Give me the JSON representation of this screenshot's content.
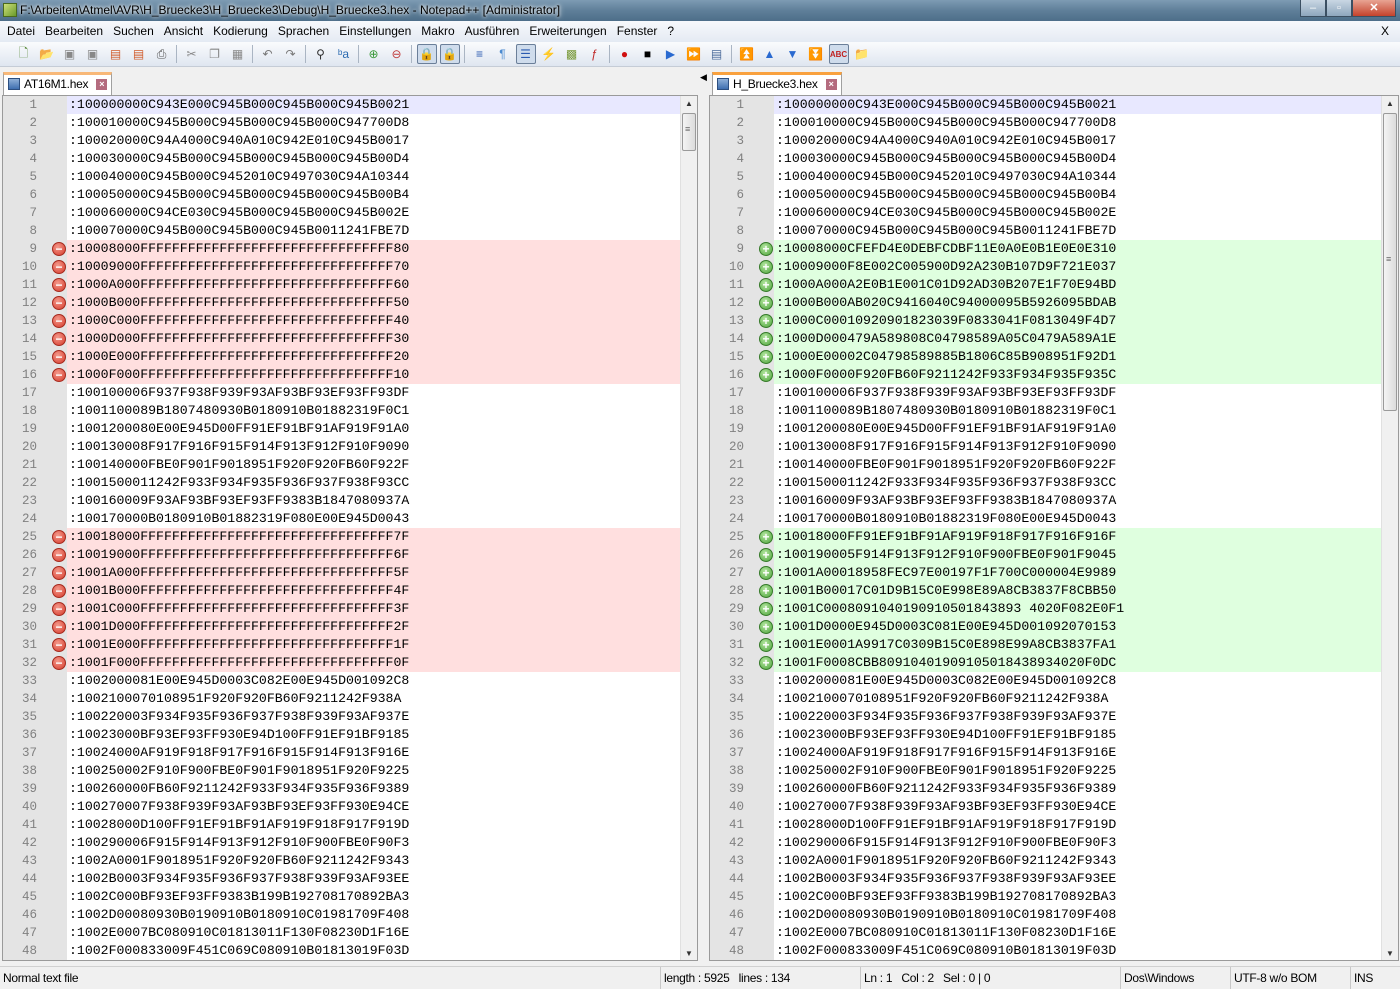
{
  "window": {
    "title": "F:\\Arbeiten\\Atmel\\AVR\\H_Bruecke3\\H_Bruecke3\\Debug\\H_Bruecke3.hex - Notepad++ [Administrator]",
    "minimize": "–",
    "maximize": "▫",
    "close": "✕"
  },
  "menu": {
    "items": [
      "Datei",
      "Bearbeiten",
      "Suchen",
      "Ansicht",
      "Kodierung",
      "Sprachen",
      "Einstellungen",
      "Makro",
      "Ausführen",
      "Erweiterungen",
      "Fenster",
      "?"
    ],
    "close": "X"
  },
  "toolbar": [
    {
      "name": "new-file-icon",
      "g": "🗋",
      "c": "#5a8a3a"
    },
    {
      "name": "open-file-icon",
      "g": "📂",
      "c": "#d9a520"
    },
    {
      "name": "save-icon",
      "g": "▣",
      "c": "#888"
    },
    {
      "name": "save-all-icon",
      "g": "▣",
      "c": "#888"
    },
    {
      "name": "close-icon",
      "g": "▤",
      "c": "#d05a2a"
    },
    {
      "name": "close-all-icon",
      "g": "▤",
      "c": "#d05a2a"
    },
    {
      "name": "print-icon",
      "g": "⎙",
      "c": "#555"
    },
    {
      "sep": true
    },
    {
      "name": "cut-icon",
      "g": "✂",
      "c": "#888"
    },
    {
      "name": "copy-icon",
      "g": "❐",
      "c": "#888"
    },
    {
      "name": "paste-icon",
      "g": "▦",
      "c": "#888"
    },
    {
      "sep": true
    },
    {
      "name": "undo-icon",
      "g": "↶",
      "c": "#777"
    },
    {
      "name": "redo-icon",
      "g": "↷",
      "c": "#777"
    },
    {
      "sep": true
    },
    {
      "name": "find-icon",
      "g": "⚲",
      "c": "#333"
    },
    {
      "name": "replace-icon",
      "g": "ᵇa",
      "c": "#2a6ab0"
    },
    {
      "sep": true
    },
    {
      "name": "zoom-in-icon",
      "g": "⊕",
      "c": "#3a9a3a"
    },
    {
      "name": "zoom-out-icon",
      "g": "⊖",
      "c": "#c03a3a"
    },
    {
      "sep": true
    },
    {
      "name": "sync-vertical-icon",
      "g": "🔒",
      "c": "#c9a030",
      "pressed": true
    },
    {
      "name": "sync-horizontal-icon",
      "g": "🔒",
      "c": "#c9a030",
      "pressed": true
    },
    {
      "sep": true
    },
    {
      "name": "word-wrap-icon",
      "g": "≡",
      "c": "#2a5ab0"
    },
    {
      "name": "show-all-chars-icon",
      "g": "¶",
      "c": "#4a8ad0"
    },
    {
      "name": "indent-guide-icon",
      "g": "☰",
      "c": "#2a5ab0",
      "pressed": true
    },
    {
      "name": "user-language-icon",
      "g": "⚡",
      "c": "#d0a020"
    },
    {
      "name": "document-map-icon",
      "g": "▩",
      "c": "#7a9a3a"
    },
    {
      "name": "function-list-icon",
      "g": "ƒ",
      "c": "#c02a2a"
    },
    {
      "sep": true
    },
    {
      "name": "record-macro-icon",
      "g": "●",
      "c": "#d01010"
    },
    {
      "name": "stop-macro-icon",
      "g": "■",
      "c": "#000"
    },
    {
      "name": "play-macro-icon",
      "g": "▶",
      "c": "#2a6ad0"
    },
    {
      "name": "run-macro-multiple-icon",
      "g": "⏩",
      "c": "#2a6ad0"
    },
    {
      "name": "save-macro-icon",
      "g": "▤",
      "c": "#4a6a9a"
    },
    {
      "sep": true
    },
    {
      "name": "first-diff-icon",
      "g": "⏫",
      "c": "#2a6ad0"
    },
    {
      "name": "prev-diff-icon",
      "g": "▲",
      "c": "#2a6ad0"
    },
    {
      "name": "next-diff-icon",
      "g": "▼",
      "c": "#2a6ad0"
    },
    {
      "name": "last-diff-icon",
      "g": "⏬",
      "c": "#2a6ad0"
    },
    {
      "name": "spell-check-icon",
      "g": "ABC",
      "c": "#c02020",
      "pressed": true
    },
    {
      "name": "plugin-folder-icon",
      "g": "📁",
      "c": "#d0a020"
    }
  ],
  "tabs": {
    "left": {
      "label": "AT16M1.hex"
    },
    "right": {
      "label": "H_Bruecke3.hex"
    }
  },
  "panes": {
    "left": [
      {
        "n": "1",
        "t": ":100000000C943E000C945B000C945B000C945B0021",
        "m": "cur"
      },
      {
        "n": "2",
        "t": ":100010000C945B000C945B000C945B000C947700D8"
      },
      {
        "n": "3",
        "t": ":100020000C94A4000C940A010C942E010C945B0017"
      },
      {
        "n": "4",
        "t": ":100030000C945B000C945B000C945B000C945B00D4"
      },
      {
        "n": "5",
        "t": ":100040000C945B000C9452010C9497030C94A10344"
      },
      {
        "n": "6",
        "t": ":100050000C945B000C945B000C945B000C945B00B4"
      },
      {
        "n": "7",
        "t": ":100060000C94CE030C945B000C945B000C945B002E"
      },
      {
        "n": "8",
        "t": ":100070000C945B000C945B000C945B0011241FBE7D"
      },
      {
        "n": "9",
        "t": ":10008000FFFFFFFFFFFFFFFFFFFFFFFFFFFFFFFF80",
        "m": "del"
      },
      {
        "n": "10",
        "t": ":10009000FFFFFFFFFFFFFFFFFFFFFFFFFFFFFFFF70",
        "m": "del"
      },
      {
        "n": "11",
        "t": ":1000A000FFFFFFFFFFFFFFFFFFFFFFFFFFFFFFFF60",
        "m": "del"
      },
      {
        "n": "12",
        "t": ":1000B000FFFFFFFFFFFFFFFFFFFFFFFFFFFFFFFF50",
        "m": "del"
      },
      {
        "n": "13",
        "t": ":1000C000FFFFFFFFFFFFFFFFFFFFFFFFFFFFFFFF40",
        "m": "del"
      },
      {
        "n": "14",
        "t": ":1000D000FFFFFFFFFFFFFFFFFFFFFFFFFFFFFFFF30",
        "m": "del"
      },
      {
        "n": "15",
        "t": ":1000E000FFFFFFFFFFFFFFFFFFFFFFFFFFFFFFFF20",
        "m": "del"
      },
      {
        "n": "16",
        "t": ":1000F000FFFFFFFFFFFFFFFFFFFFFFFFFFFFFFFF10",
        "m": "del"
      },
      {
        "n": "17",
        "t": ":100100006F937F938F939F93AF93BF93EF93FF93DF"
      },
      {
        "n": "18",
        "t": ":1001100089B1807480930B0180910B01882319F0C1"
      },
      {
        "n": "19",
        "t": ":1001200080E00E945D00FF91EF91BF91AF919F91A0"
      },
      {
        "n": "20",
        "t": ":100130008F917F916F915F914F913F912F910F9090"
      },
      {
        "n": "21",
        "t": ":100140000FBE0F901F9018951F920F920FB60F922F"
      },
      {
        "n": "22",
        "t": ":1001500011242F933F934F935F936F937F938F93CC"
      },
      {
        "n": "23",
        "t": ":100160009F93AF93BF93EF93FF9383B1847080937A"
      },
      {
        "n": "24",
        "t": ":100170000B0180910B01882319F080E00E945D0043"
      },
      {
        "n": "25",
        "t": ":10018000FFFFFFFFFFFFFFFFFFFFFFFFFFFFFFFF7F",
        "m": "del"
      },
      {
        "n": "26",
        "t": ":10019000FFFFFFFFFFFFFFFFFFFFFFFFFFFFFFFF6F",
        "m": "del"
      },
      {
        "n": "27",
        "t": ":1001A000FFFFFFFFFFFFFFFFFFFFFFFFFFFFFFFF5F",
        "m": "del"
      },
      {
        "n": "28",
        "t": ":1001B000FFFFFFFFFFFFFFFFFFFFFFFFFFFFFFFF4F",
        "m": "del"
      },
      {
        "n": "29",
        "t": ":1001C000FFFFFFFFFFFFFFFFFFFFFFFFFFFFFFFF3F",
        "m": "del"
      },
      {
        "n": "30",
        "t": ":1001D000FFFFFFFFFFFFFFFFFFFFFFFFFFFFFFFF2F",
        "m": "del"
      },
      {
        "n": "31",
        "t": ":1001E000FFFFFFFFFFFFFFFFFFFFFFFFFFFFFFFF1F",
        "m": "del"
      },
      {
        "n": "32",
        "t": ":1001F000FFFFFFFFFFFFFFFFFFFFFFFFFFFFFFFF0F",
        "m": "del"
      },
      {
        "n": "33",
        "t": ":1002000081E00E945D0003C082E00E945D001092C8"
      },
      {
        "n": "34",
        "t": ":1002100070108951F920F920FB60F9211242F938A"
      },
      {
        "n": "35",
        "t": ":100220003F934F935F936F937F938F939F93AF937E"
      },
      {
        "n": "36",
        "t": ":10023000BF93EF93FF930E94D100FF91EF91BF9185"
      },
      {
        "n": "37",
        "t": ":10024000AF919F918F917F916F915F914F913F916E"
      },
      {
        "n": "38",
        "t": ":100250002F910F900FBE0F901F9018951F920F9225"
      },
      {
        "n": "39",
        "t": ":100260000FB60F9211242F933F934F935F936F9389"
      },
      {
        "n": "40",
        "t": ":100270007F938F939F93AF93BF93EF93FF930E94CE"
      },
      {
        "n": "41",
        "t": ":10028000D100FF91EF91BF91AF919F918F917F919D"
      },
      {
        "n": "42",
        "t": ":100290006F915F914F913F912F910F900FBE0F90F3"
      },
      {
        "n": "43",
        "t": ":1002A0001F9018951F920F920FB60F9211242F9343"
      },
      {
        "n": "44",
        "t": ":1002B0003F934F935F936F937F938F939F93AF93EE"
      },
      {
        "n": "45",
        "t": ":1002C000BF93EF93FF9383B199B192708170892BA3"
      },
      {
        "n": "46",
        "t": ":1002D00080930B0190910B0180910C01981709F408"
      },
      {
        "n": "47",
        "t": ":1002E0007BC080910C01813011F130F08230D1F16E"
      },
      {
        "n": "48",
        "t": ":1002F000833009F451C069C080910B01813019F03D"
      }
    ],
    "right": [
      {
        "n": "1",
        "t": ":100000000C943E000C945B000C945B000C945B0021",
        "m": "cur"
      },
      {
        "n": "2",
        "t": ":100010000C945B000C945B000C945B000C947700D8"
      },
      {
        "n": "3",
        "t": ":100020000C94A4000C940A010C942E010C945B0017"
      },
      {
        "n": "4",
        "t": ":100030000C945B000C945B000C945B000C945B00D4"
      },
      {
        "n": "5",
        "t": ":100040000C945B000C9452010C9497030C94A10344"
      },
      {
        "n": "6",
        "t": ":100050000C945B000C945B000C945B000C945B00B4"
      },
      {
        "n": "7",
        "t": ":100060000C94CE030C945B000C945B000C945B002E"
      },
      {
        "n": "8",
        "t": ":100070000C945B000C945B000C945B0011241FBE7D"
      },
      {
        "n": "9",
        "t": ":10008000CFEFD4E0DEBFCDBF11E0A0E0B1E0E0E310",
        "m": "add"
      },
      {
        "n": "10",
        "t": ":10009000F8E002C005900D92A230B107D9F721E037",
        "m": "add"
      },
      {
        "n": "11",
        "t": ":1000A000A2E0B1E001C01D92AD30B207E1F70E94BD",
        "m": "add"
      },
      {
        "n": "12",
        "t": ":1000B000AB020C9416040C94000095B5926095BDAB",
        "m": "add"
      },
      {
        "n": "13",
        "t": ":1000C00010920901823039F0833041F0813049F4D7",
        "m": "add"
      },
      {
        "n": "14",
        "t": ":1000D000479A589808C04798589A05C0479A589A1E",
        "m": "add"
      },
      {
        "n": "15",
        "t": ":1000E00002C04798589885B1806C85B908951F92D1",
        "m": "add"
      },
      {
        "n": "16",
        "t": ":1000F0000F920FB60F9211242F933F934F935F935C",
        "m": "add"
      },
      {
        "n": "17",
        "t": ":100100006F937F938F939F93AF93BF93EF93FF93DF"
      },
      {
        "n": "18",
        "t": ":1001100089B1807480930B0180910B01882319F0C1"
      },
      {
        "n": "19",
        "t": ":1001200080E00E945D00FF91EF91BF91AF919F91A0"
      },
      {
        "n": "20",
        "t": ":100130008F917F916F915F914F913F912F910F9090"
      },
      {
        "n": "21",
        "t": ":100140000FBE0F901F9018951F920F920FB60F922F"
      },
      {
        "n": "22",
        "t": ":1001500011242F933F934F935F936F937F938F93CC"
      },
      {
        "n": "23",
        "t": ":100160009F93AF93BF93EF93FF9383B1847080937A"
      },
      {
        "n": "24",
        "t": ":100170000B0180910B01882319F080E00E945D0043"
      },
      {
        "n": "25",
        "t": ":10018000FF91EF91BF91AF919F918F917F916F916F",
        "m": "add"
      },
      {
        "n": "26",
        "t": ":100190005F914F913F912F910F900FBE0F901F9045",
        "m": "add"
      },
      {
        "n": "27",
        "t": ":1001A00018958FEC97E00197F1F700C000004E9989",
        "m": "add"
      },
      {
        "n": "28",
        "t": ":1001B00017C01D9B15C0E998E89A8CB3837F8CBB50",
        "m": "add"
      },
      {
        "n": "29",
        "t": ":1001C0008091040190910501843893 4020F082E0F1",
        "m": "add"
      },
      {
        "n": "30",
        "t": ":1001D0000E945D0003C081E00E945D001092070153",
        "m": "add"
      },
      {
        "n": "31",
        "t": ":1001E0001A9917C0309B15C0E898E99A8CB3837FA1",
        "m": "add"
      },
      {
        "n": "32",
        "t": ":1001F0008CBB80910401909105018438934020F0DC",
        "m": "add"
      },
      {
        "n": "33",
        "t": ":1002000081E00E945D0003C082E00E945D001092C8"
      },
      {
        "n": "34",
        "t": ":1002100070108951F920F920FB60F9211242F938A"
      },
      {
        "n": "35",
        "t": ":100220003F934F935F936F937F938F939F93AF937E"
      },
      {
        "n": "36",
        "t": ":10023000BF93EF93FF930E94D100FF91EF91BF9185"
      },
      {
        "n": "37",
        "t": ":10024000AF919F918F917F916F915F914F913F916E"
      },
      {
        "n": "38",
        "t": ":100250002F910F900FBE0F901F9018951F920F9225"
      },
      {
        "n": "39",
        "t": ":100260000FB60F9211242F933F934F935F936F9389"
      },
      {
        "n": "40",
        "t": ":100270007F938F939F93AF93BF93EF93FF930E94CE"
      },
      {
        "n": "41",
        "t": ":10028000D100FF91EF91BF91AF919F918F917F919D"
      },
      {
        "n": "42",
        "t": ":100290006F915F914F913F912F910F900FBE0F90F3"
      },
      {
        "n": "43",
        "t": ":1002A0001F9018951F920F920FB60F9211242F9343"
      },
      {
        "n": "44",
        "t": ":1002B0003F934F935F936F937F938F939F93AF93EE"
      },
      {
        "n": "45",
        "t": ":1002C000BF93EF93FF9383B199B192708170892BA3"
      },
      {
        "n": "46",
        "t": ":1002D00080930B0190910B0180910C01981709F408"
      },
      {
        "n": "47",
        "t": ":1002E0007BC080910C01813011F130F08230D1F16E"
      },
      {
        "n": "48",
        "t": ":1002F000833009F451C069C080910B01813019F03D"
      }
    ]
  },
  "markers": {
    "del": "−",
    "add": "+"
  },
  "scroll": {
    "up": "▲",
    "down": "▼",
    "grip": "≡"
  },
  "statusbar": {
    "type": "Normal text file",
    "length": "length : 5925",
    "lines": "lines : 134",
    "ln": "Ln : 1",
    "col": "Col : 2",
    "sel": "Sel : 0 | 0",
    "eol": "Dos\\Windows",
    "encoding": "UTF-8 w/o BOM",
    "mode": "INS"
  },
  "colors": {
    "deleted": "#ffdfdf",
    "added": "#dfffdf",
    "current_line": "#e8e8ff",
    "gutter": "#e4e4e4"
  }
}
